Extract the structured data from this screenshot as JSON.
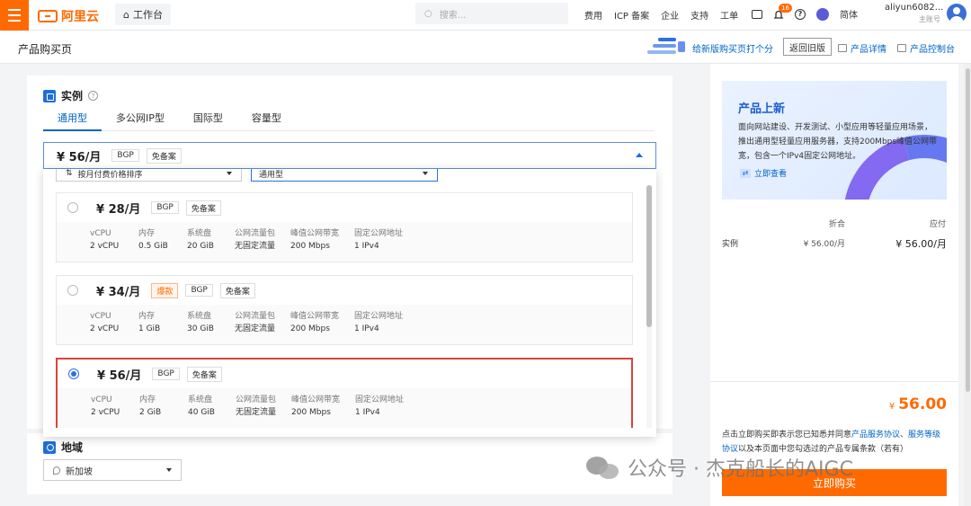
{
  "topbar": {
    "logo_text": "阿里云",
    "workspace_label": "工作台",
    "search_placeholder": "搜索...",
    "nav": [
      "费用",
      "ICP 备案",
      "企业",
      "支持",
      "工单"
    ],
    "notification_count": "16",
    "language": "简体",
    "account_name": "aliyun6082...",
    "account_role": "主账号"
  },
  "subbar": {
    "page_title": "产品购买页",
    "survey_link": "给新版购买页打个分",
    "back_old_label": "返回旧版",
    "product_detail_label": "产品详情",
    "product_console_label": "产品控制台"
  },
  "instance": {
    "section_title": "实例",
    "help_glyph": "?",
    "tabs": [
      "通用型",
      "多公网IP型",
      "国际型",
      "容量型"
    ],
    "active_tab": 0,
    "selected": {
      "price": "¥ 56/月",
      "tags": [
        "BGP",
        "免备案"
      ]
    },
    "filters": {
      "sort_label": "按月付费价格排序",
      "type_label": "通用型"
    },
    "spec_headers": [
      "vCPU",
      "内存",
      "系统盘",
      "公网流量包",
      "峰值公网带宽",
      "固定公网地址"
    ],
    "options": [
      {
        "price": "¥ 28/月",
        "tags": [
          "BGP",
          "免备案"
        ],
        "hot": "",
        "selected": false,
        "values": [
          "2 vCPU",
          "0.5 GiB",
          "20 GiB",
          "无固定流量",
          "200 Mbps",
          "1 IPv4"
        ]
      },
      {
        "price": "¥ 34/月",
        "tags": [
          "BGP",
          "免备案"
        ],
        "hot": "爆款",
        "selected": false,
        "values": [
          "2 vCPU",
          "1 GiB",
          "30 GiB",
          "无固定流量",
          "200 Mbps",
          "1 IPv4"
        ]
      },
      {
        "price": "¥ 56/月",
        "tags": [
          "BGP",
          "免备案"
        ],
        "hot": "",
        "selected": true,
        "values": [
          "2 vCPU",
          "2 GiB",
          "40 GiB",
          "无固定流量",
          "200 Mbps",
          "1 IPv4"
        ]
      }
    ]
  },
  "region": {
    "section_title": "地域",
    "value": "新加坡"
  },
  "sidebar": {
    "promo_title": "产品上新",
    "promo_text": "面向网站建设、开发测试、小型应用等轻量应用场景，推出通用型轻量应用服务器，支持200Mbps峰值公网带宽，包含一个IPv4固定公网地址。",
    "promo_link": "立即查看",
    "col_discount": "折合",
    "col_payable": "应付",
    "row_label": "实例",
    "row_discount": "¥ 56.00/月",
    "row_payable": "¥ 56.00/月",
    "currency": "¥",
    "total": "56.00",
    "agree_prefix": "点击立即购买即表示您已知悉并同意",
    "agree_link1": "产品服务协议",
    "agree_sep": "、",
    "agree_link2": "服务等级协议",
    "agree_suffix": "以及本页面中您勾选过的产品专属条款（若有）",
    "buy_label": "立即购买"
  },
  "watermark": "公众号 · 杰克船长的AIGC",
  "colors": {
    "brand": "#ff6a00",
    "link": "#0064c8",
    "selected_border": "#d8453a"
  }
}
